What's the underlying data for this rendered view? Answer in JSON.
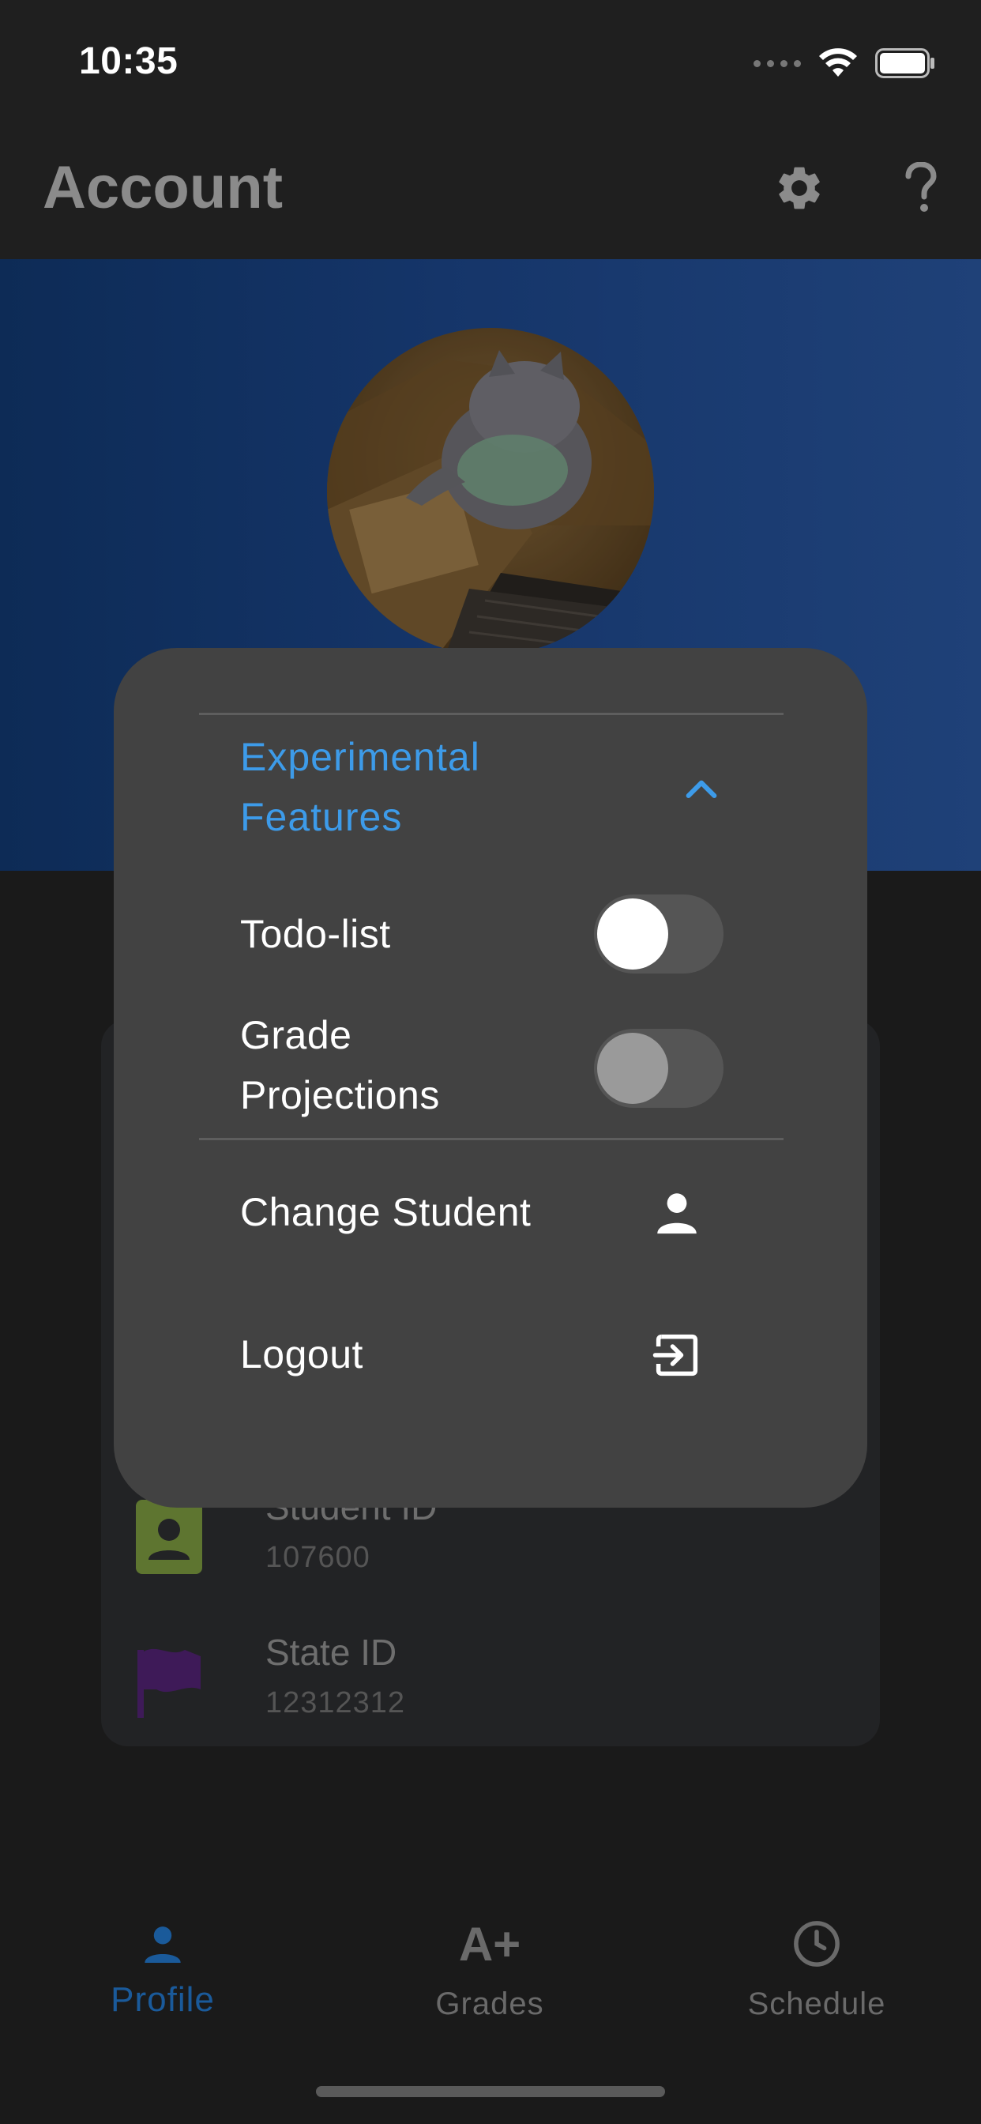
{
  "status_bar": {
    "time": "10:35",
    "icons": [
      "signal-icon",
      "wifi-icon",
      "battery-icon"
    ]
  },
  "app_bar": {
    "title": "Account",
    "icons": [
      "gear-icon",
      "help-icon"
    ]
  },
  "profile": {
    "avatar": "cat-avatar"
  },
  "info_rows": [
    {
      "title": "Student ID",
      "value": "107600",
      "icon": "id-badge-icon",
      "color": "#7a9a3c"
    },
    {
      "title": "State ID",
      "value": "12312312",
      "icon": "flag-icon",
      "color": "#4a1a6a"
    }
  ],
  "modal": {
    "experimental_title": "Experimental\nFeatures",
    "toggles": [
      {
        "label": "Todo-list",
        "knob_color": "#ffffff"
      },
      {
        "label": "Grade\nProjections",
        "knob_color": "#9a9a9a"
      }
    ],
    "actions": [
      {
        "label": "Change Student",
        "icon": "person-icon"
      },
      {
        "label": "Logout",
        "icon": "logout-icon"
      }
    ]
  },
  "bottom_nav": {
    "items": [
      {
        "label": "Profile",
        "icon": "person-icon",
        "active": true
      },
      {
        "label": "Grades",
        "icon": "grade-aplus-icon",
        "active": false
      },
      {
        "label": "Schedule",
        "icon": "clock-icon",
        "active": false
      }
    ],
    "icon_glyph_grades": "A+",
    "active_color": "#1a5a9a",
    "inactive_color": "#6a6a6a"
  },
  "colors": {
    "accent": "#3d9be9",
    "modal_bg": "#424242",
    "header_blue": "#153569"
  }
}
